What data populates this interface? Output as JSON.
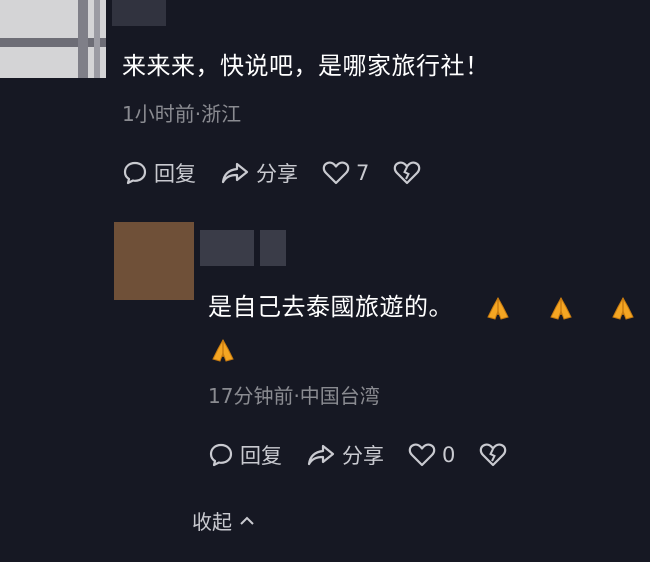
{
  "comment1": {
    "text": "来来来，快说吧，是哪家旅行社！",
    "meta": "1小时前·浙江",
    "reply_label": "回复",
    "share_label": "分享",
    "like_count": "7"
  },
  "comment2": {
    "text": "是自己去泰國旅遊的。",
    "emoji": "folded-hands",
    "meta": "17分钟前·中国台湾",
    "reply_label": "回复",
    "share_label": "分享",
    "like_count": "0"
  },
  "collapse_label": "收起",
  "colors": {
    "background": "#161823",
    "text": "#ffffff",
    "secondary": "#8a8b91",
    "emoji": "#f5a623"
  }
}
